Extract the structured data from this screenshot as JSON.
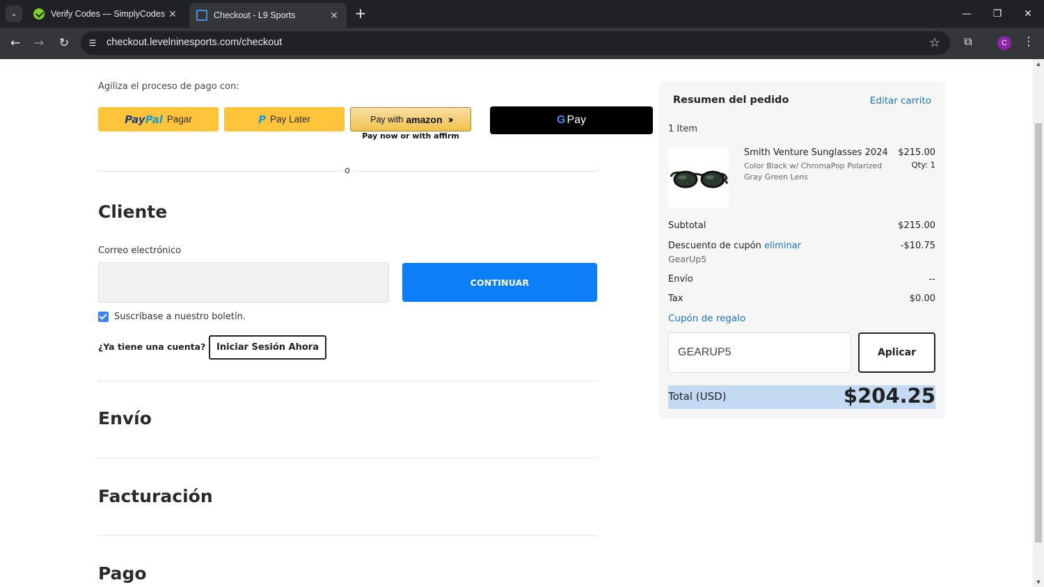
{
  "browser": {
    "tabs": [
      {
        "title": "Verify Codes — SimplyCodes",
        "active": false
      },
      {
        "title": "Checkout - L9 Sports",
        "active": true
      }
    ],
    "url": "checkout.levelninesports.com/checkout",
    "profile_initial": "C"
  },
  "express": {
    "label": "Agiliza el proceso de pago con:",
    "paypal_logo_a": "Pay",
    "paypal_logo_b": "Pal",
    "paypal_text": "Pagar",
    "paylater_text": "Pay Later",
    "amazon_text": "Pay with",
    "amazon_logo": "amazon",
    "affirm_note": "Pay now or with affirm",
    "gpay_text": "Pay"
  },
  "divider_text": "o",
  "customer": {
    "title": "Cliente",
    "email_label": "Correo electrónico",
    "email_value": "",
    "continue_label": "CONTINUAR",
    "newsletter_label": "Suscríbase a nuestro boletín.",
    "newsletter_checked": true,
    "account_question": "¿Ya tiene una cuenta?",
    "login_label": "Iniciar Sesión Ahora"
  },
  "sections": {
    "shipping": "Envío",
    "billing": "Facturación",
    "payment": "Pago"
  },
  "summary": {
    "title": "Resumen del pedido",
    "edit_cart": "Editar carrito",
    "item_count": "1 Item",
    "product": {
      "name": "Smith Venture Sunglasses 2024",
      "options": "Color Black w/ ChromaPop Polarized Gray Green Lens",
      "price": "$215.00",
      "qty": "Qty: 1"
    },
    "subtotal_label": "Subtotal",
    "subtotal_value": "$215.00",
    "discount_label": "Descuento de cupón",
    "discount_remove": "eliminar",
    "discount_value": "-$10.75",
    "discount_code": "GearUp5",
    "shipping_label": "Envío",
    "shipping_value": "--",
    "tax_label": "Tax",
    "tax_value": "$0.00",
    "gift_link": "Cupón de regalo",
    "coupon_value": "GEARUP5",
    "apply_label": "Aplicar",
    "total_label": "Total (USD)",
    "total_value": "$204.25"
  },
  "colors": {
    "primary_button": "#0c7ef7",
    "link": "#1a73c8",
    "paypal_yellow": "#ffc439",
    "total_highlight": "#c4daf2"
  }
}
